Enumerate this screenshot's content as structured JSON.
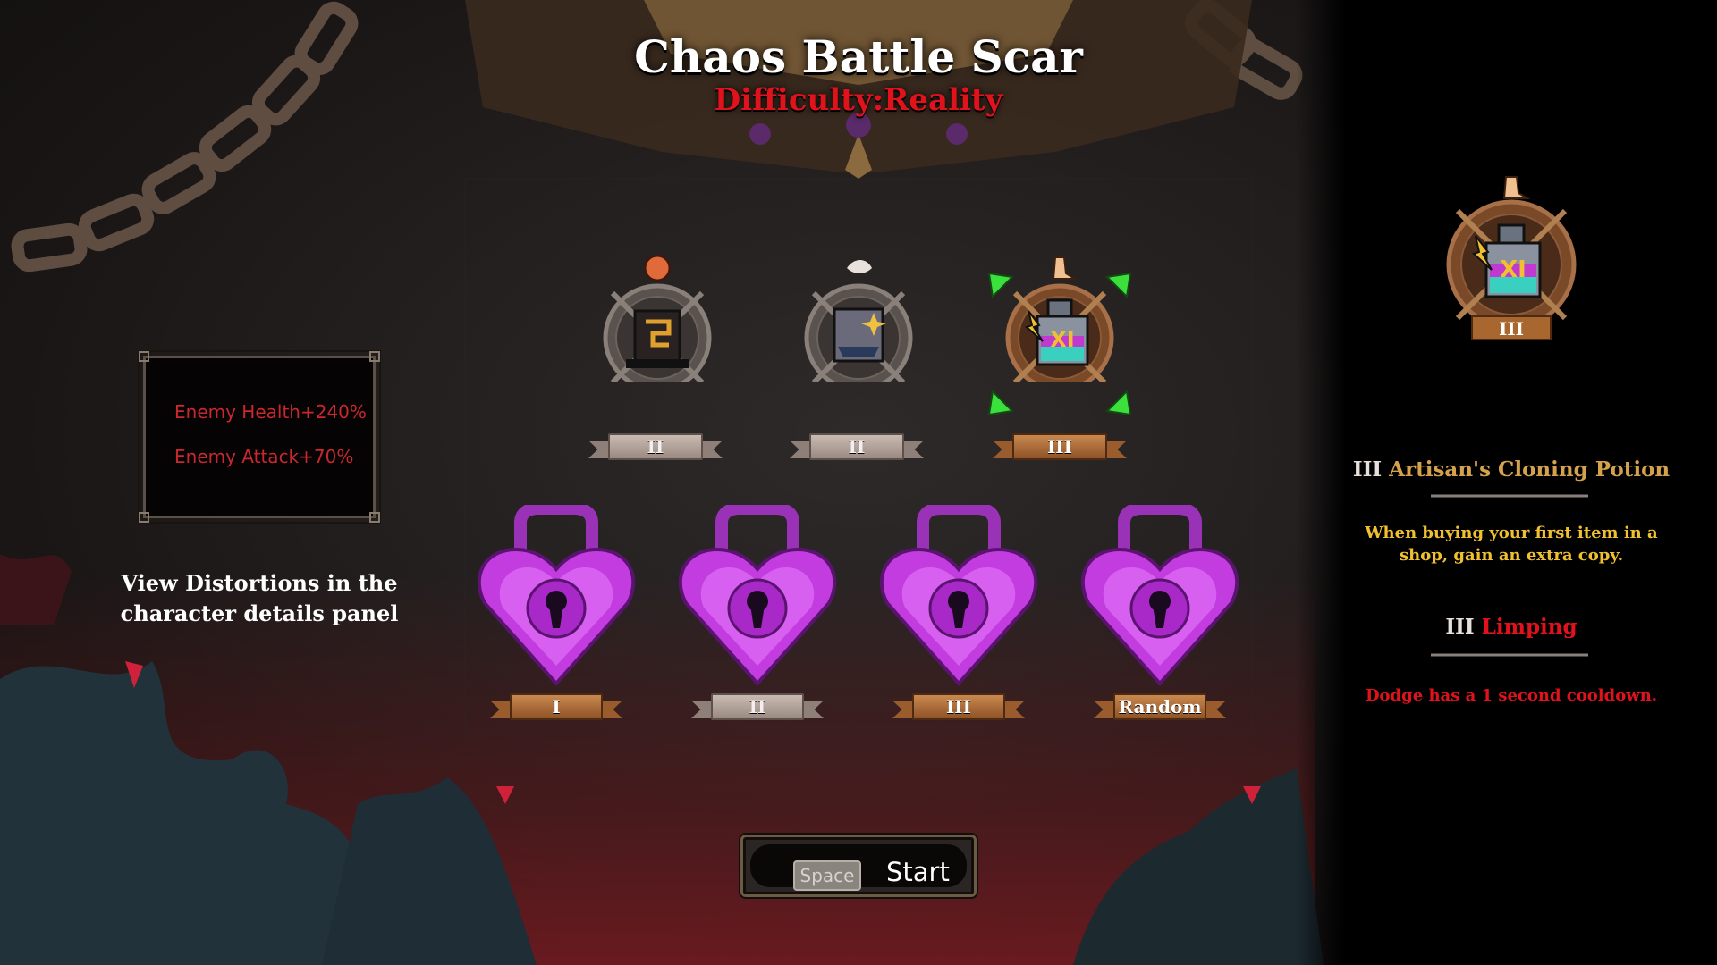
{
  "header": {
    "title": "Chaos Battle Scar",
    "difficulty": "Difficulty:Reality"
  },
  "stats": {
    "lines": [
      "Enemy Health+240%",
      "Enemy Attack+70%"
    ]
  },
  "view_note": {
    "line1": "View Distortions in the",
    "line2": "character details panel"
  },
  "badges": [
    {
      "icon": "stone-tablet-rune-icon",
      "top_icon": "brain-icon",
      "level": "II",
      "state": "inactive"
    },
    {
      "icon": "ship-fortress-icon",
      "top_icon": "bird-icon",
      "level": "II",
      "state": "inactive"
    },
    {
      "icon": "cloning-potion-icon",
      "top_icon": "foot-icon",
      "level": "III",
      "state": "selected"
    }
  ],
  "locks": [
    {
      "level": "I"
    },
    {
      "level": "II"
    },
    {
      "level": "III"
    },
    {
      "level": "Random"
    }
  ],
  "start_button": {
    "key": "Space",
    "label": "Start"
  },
  "detail_panel": {
    "selected_level": "III",
    "selected_icon": "cloning-potion-icon",
    "blessing": {
      "level": "III",
      "name": "Artisan's Cloning Potion",
      "desc_line1": "When buying your first item in a",
      "desc_line2": "shop, gain an extra copy.",
      "color": "#d4a24c"
    },
    "curse": {
      "level": "III",
      "name": "Limping",
      "desc": "Dodge has a 1 second cooldown.",
      "color": "#e0121c"
    }
  },
  "colors": {
    "title_red": "#e0121c",
    "stat_red": "#c8282e",
    "gold": "#d4a24c",
    "lock_purple": "#c23ce0",
    "select_green": "#3ce03c"
  }
}
